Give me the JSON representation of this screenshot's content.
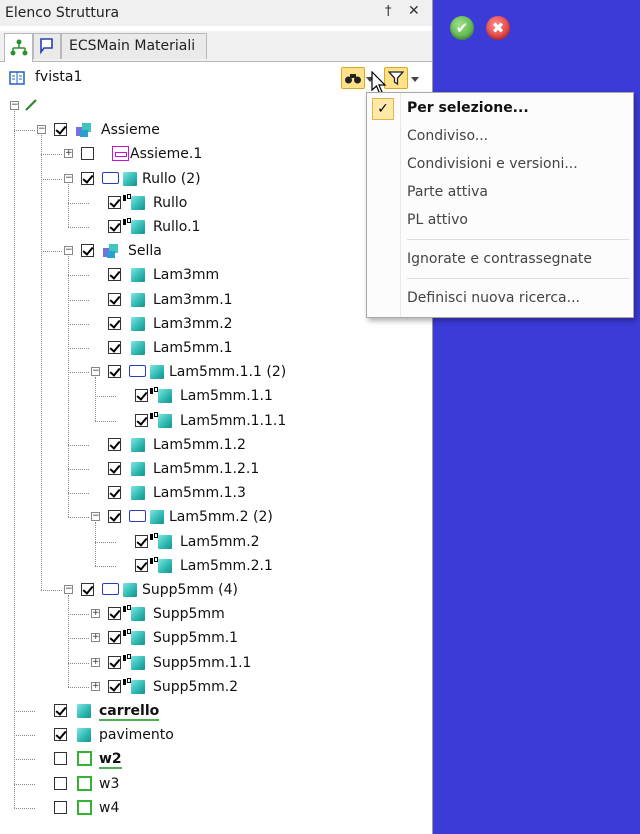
{
  "panel": {
    "title": "Elenco Struttura",
    "pin_glyph": "†",
    "close_glyph": "✕",
    "tabs": [
      {
        "icon": "structure-tree-icon",
        "label": ""
      },
      {
        "icon": "flag-icon",
        "label": ""
      },
      {
        "icon": "",
        "label": "ECSMain Materiali"
      }
    ],
    "view_name": "fvista1"
  },
  "viewport": {
    "ok_glyph": "✔",
    "cancel_glyph": "✖",
    "background": "#3b3bd8"
  },
  "tree": [
    {
      "label": "",
      "level": 0,
      "exp": "minus",
      "check": null,
      "icon": "root-line"
    },
    {
      "label": "Assieme",
      "level": 1,
      "exp": "minus",
      "check": true,
      "icon": "assembly"
    },
    {
      "label": "Assieme.1",
      "level": 2,
      "exp": "plus",
      "check": false,
      "icon": "assembly-pink"
    },
    {
      "label": "Rullo (2)",
      "level": 2,
      "exp": "minus",
      "check": true,
      "icon": "folder-cube"
    },
    {
      "label": "Rullo",
      "level": 3,
      "exp": null,
      "check": true,
      "link": true,
      "icon": "cube"
    },
    {
      "label": "Rullo.1",
      "level": 3,
      "exp": null,
      "check": true,
      "link": true,
      "icon": "cube"
    },
    {
      "label": "Sella",
      "level": 2,
      "exp": "minus",
      "check": true,
      "icon": "assembly"
    },
    {
      "label": "Lam3mm",
      "level": 3,
      "exp": null,
      "check": true,
      "icon": "cube"
    },
    {
      "label": "Lam3mm.1",
      "level": 3,
      "exp": null,
      "check": true,
      "icon": "cube"
    },
    {
      "label": "Lam3mm.2",
      "level": 3,
      "exp": null,
      "check": true,
      "icon": "cube"
    },
    {
      "label": "Lam5mm.1",
      "level": 3,
      "exp": null,
      "check": true,
      "icon": "cube"
    },
    {
      "label": "Lam5mm.1.1 (2)",
      "level": 3,
      "exp": "minus",
      "check": true,
      "icon": "folder-cube"
    },
    {
      "label": "Lam5mm.1.1",
      "level": 4,
      "exp": null,
      "check": true,
      "link": true,
      "icon": "cube"
    },
    {
      "label": "Lam5mm.1.1.1",
      "level": 4,
      "exp": null,
      "check": true,
      "link": true,
      "icon": "cube"
    },
    {
      "label": "Lam5mm.1.2",
      "level": 3,
      "exp": null,
      "check": true,
      "icon": "cube"
    },
    {
      "label": "Lam5mm.1.2.1",
      "level": 3,
      "exp": null,
      "check": true,
      "icon": "cube"
    },
    {
      "label": "Lam5mm.1.3",
      "level": 3,
      "exp": null,
      "check": true,
      "icon": "cube"
    },
    {
      "label": "Lam5mm.2 (2)",
      "level": 3,
      "exp": "minus",
      "check": true,
      "icon": "folder-cube"
    },
    {
      "label": "Lam5mm.2",
      "level": 4,
      "exp": null,
      "check": true,
      "link": true,
      "icon": "cube"
    },
    {
      "label": "Lam5mm.2.1",
      "level": 4,
      "exp": null,
      "check": true,
      "link": true,
      "icon": "cube"
    },
    {
      "label": "Supp5mm (4)",
      "level": 2,
      "exp": "minus",
      "check": true,
      "icon": "folder-cube"
    },
    {
      "label": "Supp5mm",
      "level": 3,
      "exp": "plus",
      "check": true,
      "link": true,
      "icon": "cube"
    },
    {
      "label": "Supp5mm.1",
      "level": 3,
      "exp": "plus",
      "check": true,
      "link": true,
      "icon": "cube"
    },
    {
      "label": "Supp5mm.1.1",
      "level": 3,
      "exp": "plus",
      "check": true,
      "link": true,
      "icon": "cube"
    },
    {
      "label": "Supp5mm.2",
      "level": 3,
      "exp": "plus",
      "check": true,
      "link": true,
      "icon": "cube"
    },
    {
      "label": "carrello",
      "level": 1,
      "exp": null,
      "check": true,
      "icon": "cube",
      "bold": true,
      "underline": true
    },
    {
      "label": "pavimento",
      "level": 1,
      "exp": null,
      "check": true,
      "icon": "cube"
    },
    {
      "label": "w2",
      "level": 1,
      "exp": null,
      "check": false,
      "icon": "wire",
      "bold": true,
      "underline": true
    },
    {
      "label": "w3",
      "level": 1,
      "exp": null,
      "check": false,
      "icon": "wire"
    },
    {
      "label": "w4",
      "level": 1,
      "exp": null,
      "check": false,
      "icon": "wire"
    }
  ],
  "menu": {
    "check_glyph": "✓",
    "items": [
      "Per selezione...",
      "Condiviso...",
      "Condivisioni e versioni...",
      "Parte attiva",
      "PL attivo",
      "Ignorate e contrassegnate",
      "Definisci nuova ricerca..."
    ]
  }
}
